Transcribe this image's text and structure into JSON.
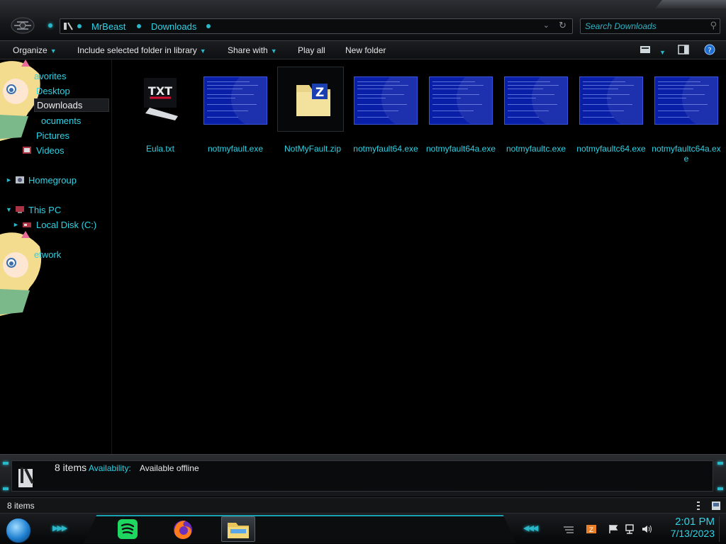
{
  "window": {
    "address": {
      "crumbs": [
        "MrBeast",
        "Downloads"
      ]
    },
    "search": {
      "placeholder": "Search Downloads"
    }
  },
  "toolbar": {
    "organize": "Organize",
    "include_library": "Include selected folder in library",
    "share_with": "Share with",
    "play_all": "Play all",
    "new_folder": "New folder"
  },
  "nav": {
    "favorites": "avorites",
    "desktop": "Desktop",
    "downloads": "Downloads",
    "documents": "ocuments",
    "pictures": "Pictures",
    "videos": "Videos",
    "homegroup": "Homegroup",
    "this_pc": "This PC",
    "local_disk": "Local Disk (C:)",
    "network": "etwork"
  },
  "files": [
    {
      "name": "Eula.txt",
      "icon": "txt-file-icon"
    },
    {
      "name": "notmyfault.exe",
      "icon": "bsod-thumbnail-icon"
    },
    {
      "name": "NotMyFault.zip",
      "icon": "zip-folder-icon"
    },
    {
      "name": "notmyfault64.exe",
      "icon": "bsod-thumbnail-icon"
    },
    {
      "name": "notmyfault64a.exe",
      "icon": "bsod-thumbnail-icon"
    },
    {
      "name": "notmyfaultc.exe",
      "icon": "bsod-thumbnail-icon"
    },
    {
      "name": "notmyfaultc64.exe",
      "icon": "bsod-thumbnail-icon"
    },
    {
      "name": "notmyfaultc64a.exe",
      "icon": "bsod-thumbnail-icon"
    }
  ],
  "details": {
    "count": "8 items",
    "availability_label": "Availability:",
    "availability_value": "Available offline"
  },
  "status": {
    "text": "8 items"
  },
  "taskbar": {
    "time": "2:01 PM",
    "date": "7/13/2023"
  },
  "colors": {
    "accent": "#2fd3e6",
    "bsod_blue": "#0a1fa8"
  }
}
